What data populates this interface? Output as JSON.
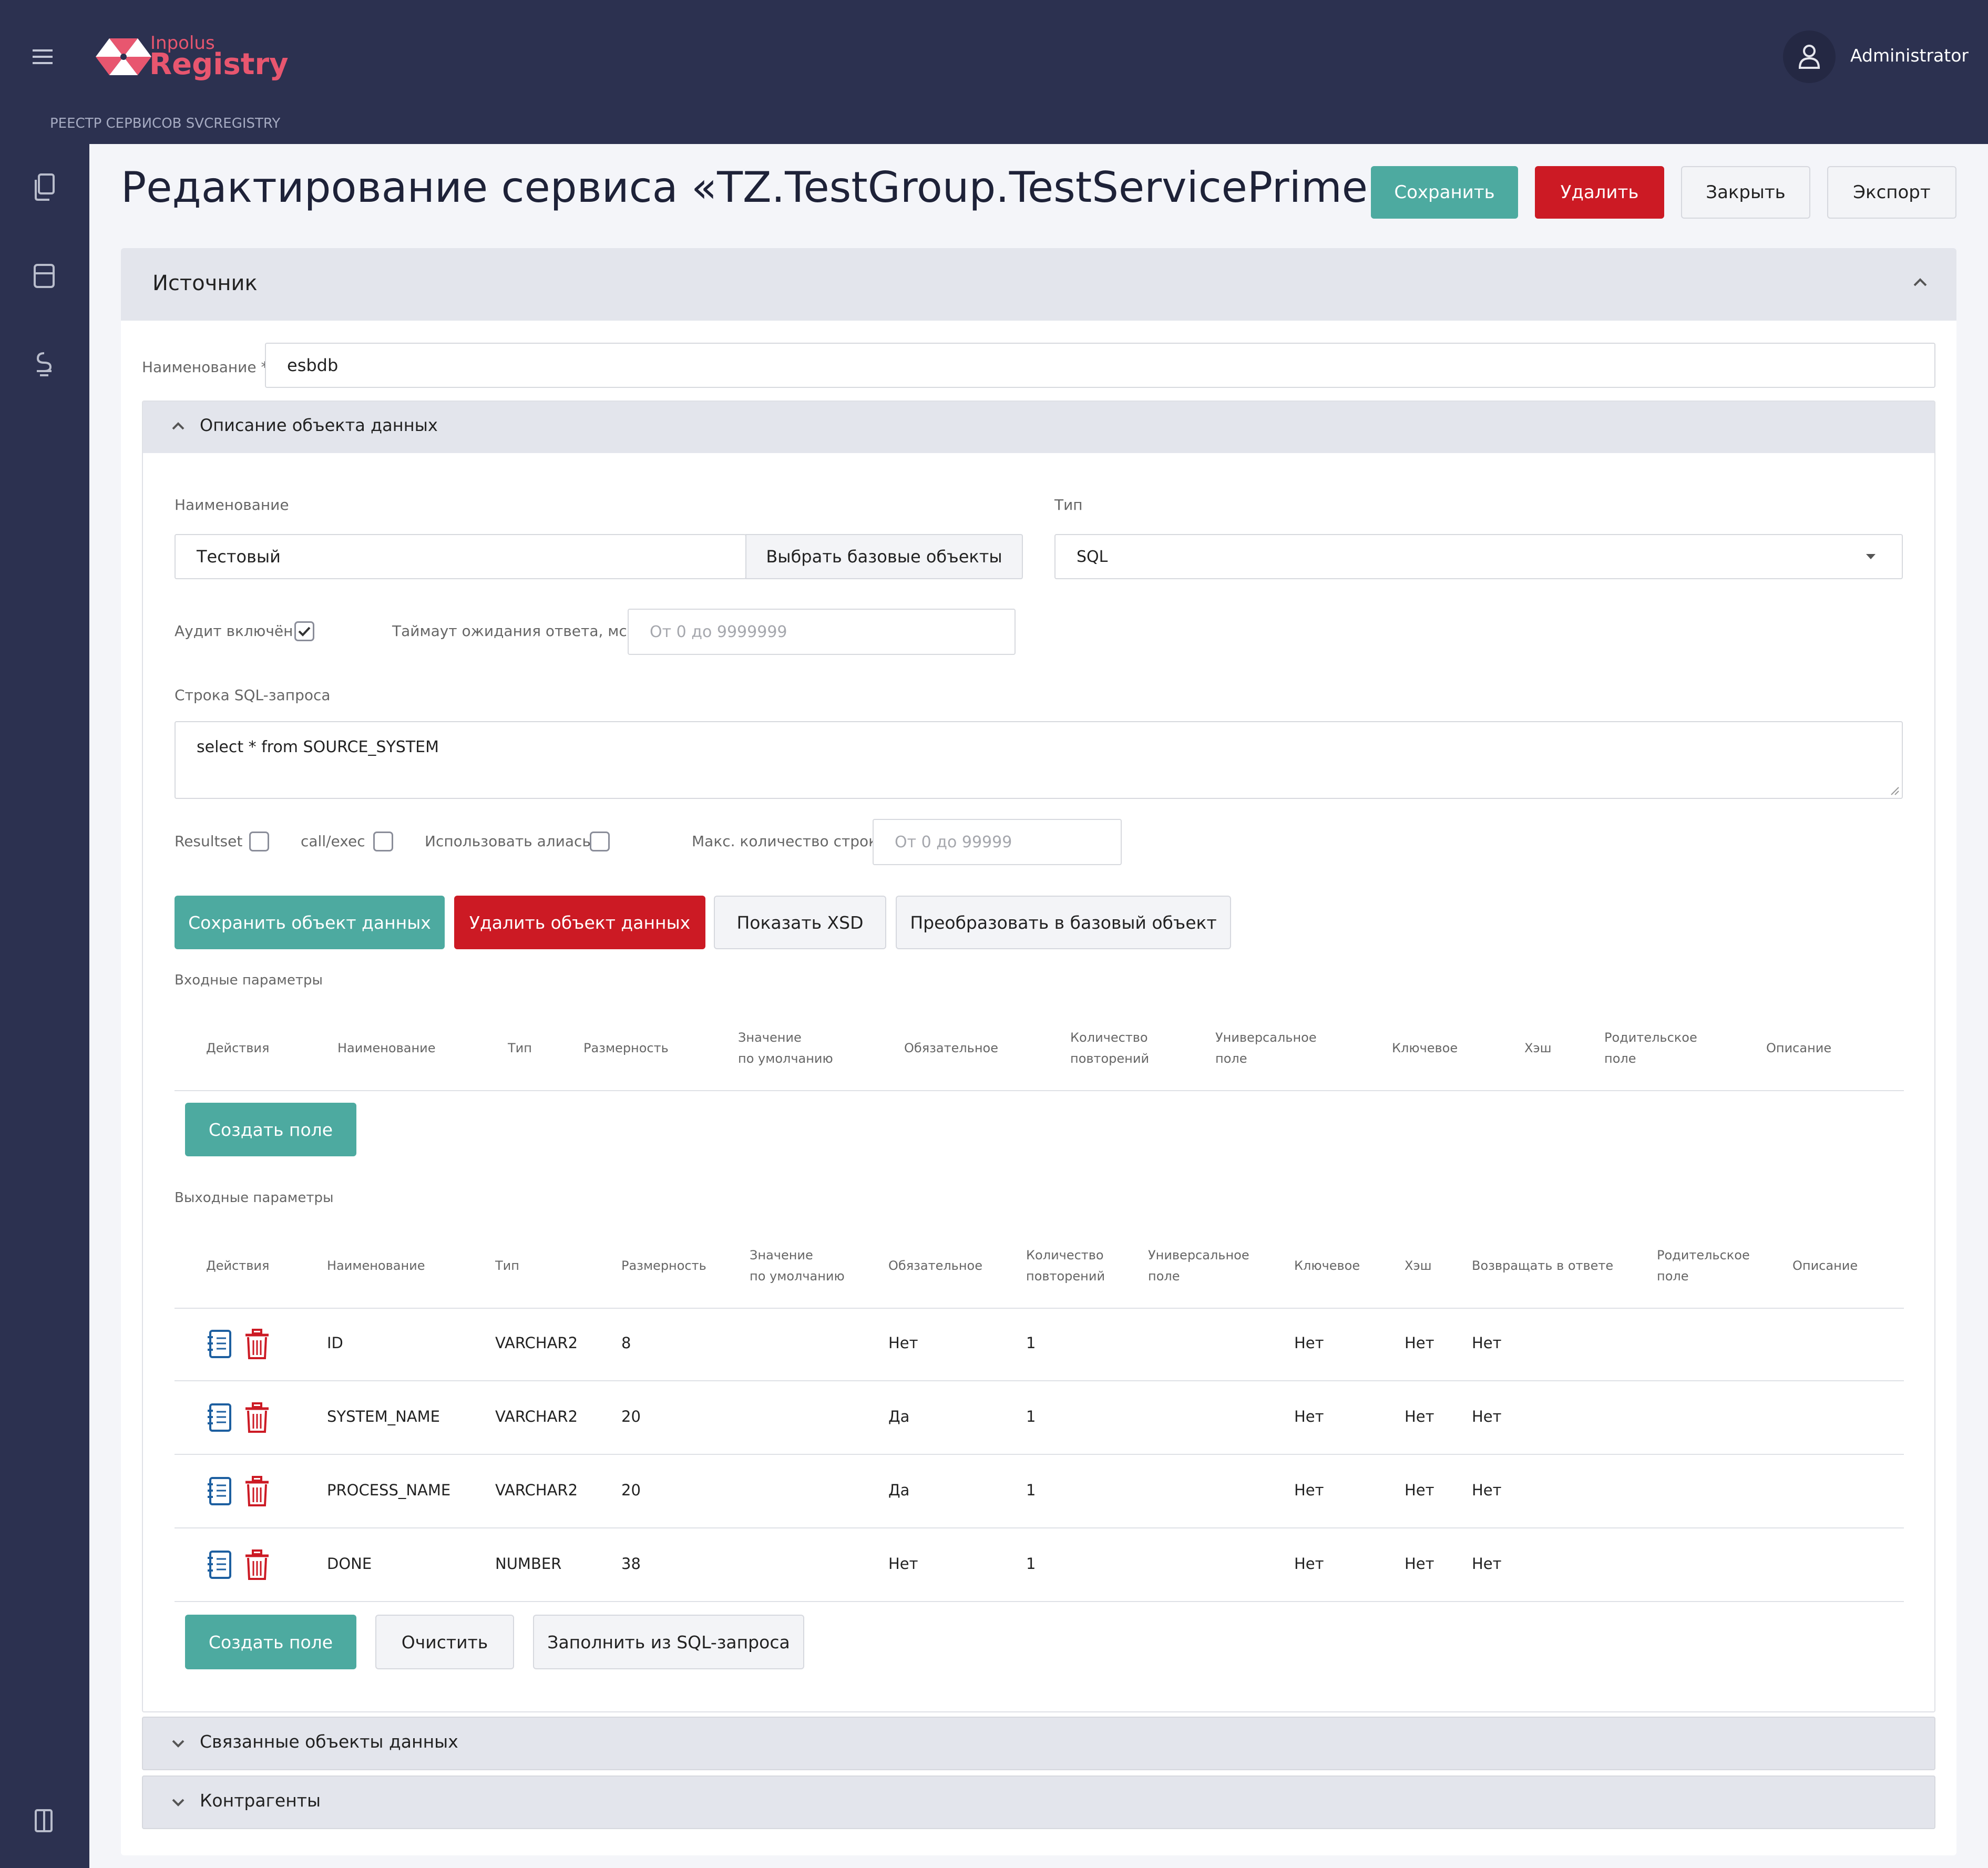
{
  "app": {
    "logo_small": "Inpolus",
    "logo_big": "Registry",
    "subtitle": "РЕЕСТР СЕРВИСОВ SVCREGISTRY",
    "user": "Administrator"
  },
  "page": {
    "title": "Редактирование сервиса «TZ.TestGroup.TestServicePrime»"
  },
  "toolbar": {
    "save": "Сохранить",
    "delete": "Удалить",
    "close": "Закрыть",
    "export": "Экспорт"
  },
  "source": {
    "section_title": "Источник",
    "name_label": "Наименование *",
    "name_value": "esbdb",
    "data_object": {
      "title": "Описание объекта данных",
      "name_label": "Наименование",
      "name_value": "Тестовый",
      "choose_base": "Выбрать базовые объекты",
      "type_label": "Тип",
      "type_value": "SQL",
      "audit_label": "Аудит включён",
      "audit_checked": true,
      "timeout_label": "Таймаут ожидания ответа, мсек.",
      "timeout_placeholder": "От 0 до 9999999",
      "sql_label": "Строка SQL-запроса",
      "sql_value": "select * from SOURCE_SYSTEM",
      "resultset_label": "Resultset",
      "callexec_label": "call/exec",
      "aliases_label": "Использовать алиасы",
      "maxrows_label": "Макс. количество строк",
      "maxrows_placeholder": "От 0 до 99999",
      "btn_save_obj": "Сохранить объект данных",
      "btn_delete_obj": "Удалить объект данных",
      "btn_show_xsd": "Показать XSD",
      "btn_convert": "Преобразовать в базовый объект"
    },
    "input_params": {
      "title": "Входные параметры",
      "headers": {
        "actions": "Действия",
        "name": "Наименование",
        "type": "Тип",
        "size": "Размерность",
        "default1": "Значение",
        "default2": "по умолчанию",
        "required": "Обязательное",
        "count1": "Количество",
        "count2": "повторений",
        "universal1": "Универсальное",
        "universal2": "поле",
        "key": "Ключевое",
        "hash": "Хэш",
        "parent1": "Родительское",
        "parent2": "поле",
        "description": "Описание"
      },
      "create_field": "Создать поле"
    },
    "output_params": {
      "title": "Выходные параметры",
      "headers": {
        "actions": "Действия",
        "name": "Наименование",
        "type": "Тип",
        "size": "Размерность",
        "default1": "Значение",
        "default2": "по умолчанию",
        "required": "Обязательное",
        "count1": "Количество",
        "count2": "повторений",
        "universal1": "Универсальное",
        "universal2": "поле",
        "key": "Ключевое",
        "hash": "Хэш",
        "return": "Возвращать в ответе",
        "parent1": "Родительское",
        "parent2": "поле",
        "description": "Описание"
      },
      "rows": [
        {
          "name": "ID",
          "type": "VARCHAR2",
          "size": "8",
          "required": "Нет",
          "count": "1",
          "key": "Нет",
          "hash": "Нет",
          "return": "Нет"
        },
        {
          "name": "SYSTEM_NAME",
          "type": "VARCHAR2",
          "size": "20",
          "required": "Да",
          "count": "1",
          "key": "Нет",
          "hash": "Нет",
          "return": "Нет"
        },
        {
          "name": "PROCESS_NAME",
          "type": "VARCHAR2",
          "size": "20",
          "required": "Да",
          "count": "1",
          "key": "Нет",
          "hash": "Нет",
          "return": "Нет"
        },
        {
          "name": "DONE",
          "type": "NUMBER",
          "size": "38",
          "required": "Нет",
          "count": "1",
          "key": "Нет",
          "hash": "Нет",
          "return": "Нет"
        }
      ],
      "create_field": "Создать поле",
      "clear": "Очистить",
      "fill_from_sql": "Заполнить из SQL-запроса"
    },
    "linked_objects": "Связанные объекты данных",
    "counterparties": "Контрагенты"
  },
  "colors": {
    "header_bg": "#2c3150",
    "accent_teal": "#4daaa0",
    "danger_red": "#cc1a24",
    "brand_pink": "#e8566f",
    "edit_icon": "#1d5fa0",
    "delete_icon": "#cc1a24"
  },
  "icons": {
    "menu": "hamburger-icon",
    "user": "user-icon",
    "nav1": "documents-icon",
    "nav2": "storage-icon",
    "nav3": "plugin-icon",
    "logout": "exit-icon",
    "edit": "edit-document-icon",
    "delete": "trash-icon",
    "collapse": "chevron-up-icon",
    "expand": "chevron-down-icon",
    "dropdown": "caret-down-icon",
    "check": "check-icon"
  }
}
